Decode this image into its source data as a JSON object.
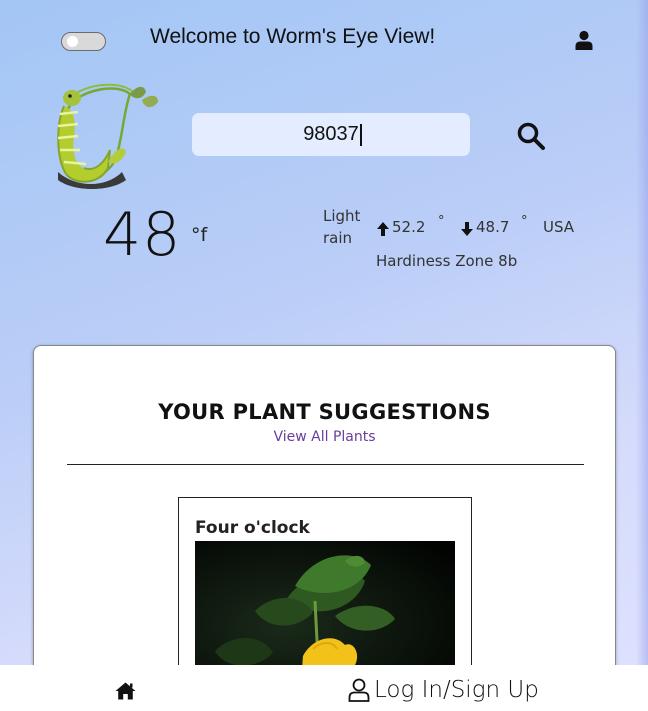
{
  "header": {
    "welcome": "Welcome to Worm's Eye View!",
    "toggle_state": "off",
    "user_icon": "user-icon"
  },
  "search": {
    "value": "98037",
    "icon": "search-icon"
  },
  "weather": {
    "temperature": "48",
    "unit": "°f",
    "condition": "Light rain",
    "high": "52.2",
    "low": "48.7",
    "degree": "°",
    "country": "USA",
    "hardiness": "Hardiness Zone 8b"
  },
  "suggestions": {
    "title": "YOUR PLANT SUGGESTIONS",
    "view_all": "View All Plants",
    "plants": [
      {
        "name": "Four o'clock"
      }
    ]
  },
  "bottom_nav": {
    "home_icon": "home-icon",
    "login_label": "Log In/Sign Up",
    "login_icon": "user-outline-icon"
  },
  "colors": {
    "link": "#6a3d9a",
    "background_start": "#a3c6f5",
    "background_end": "#dfe2ff"
  }
}
